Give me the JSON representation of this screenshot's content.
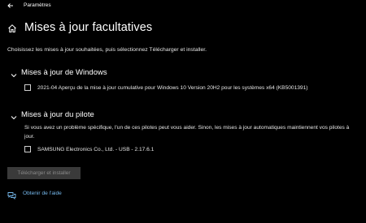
{
  "window": {
    "title": "Paramètres"
  },
  "header": {
    "title": "Mises à jour facultatives"
  },
  "intro": "Choisissez les mises à jour souhaitées, puis sélectionnez Télécharger et installer.",
  "sections": [
    {
      "title": "Mises à jour de Windows",
      "items": [
        {
          "label": "2021-04 Aperçu de la mise à jour cumulative pour Windows 10 Version 20H2 pour les systèmes x64 (KB5001391)",
          "checked": false
        }
      ]
    },
    {
      "title": "Mises à jour du pilote",
      "description": "Si vous avez un problème spécifique, l'un de ces pilotes peut vous aider. Sinon, les mises à jour automatiques maintiennent vos pilotes à jour.",
      "items": [
        {
          "label": "SAMSUNG Electronics Co., Ltd.  -  USB - 2.17.6.1",
          "checked": false
        }
      ]
    }
  ],
  "download_button": "Télécharger et installer",
  "help_link": "Obtenir de l'aide",
  "colors": {
    "background": "#000000",
    "link": "#76b9ed",
    "button_disabled": "#3a3a3a"
  },
  "icons": {
    "back": "back-arrow-icon",
    "home": "home-icon",
    "chevron": "chevron-down-icon",
    "help": "help-chat-icon"
  }
}
